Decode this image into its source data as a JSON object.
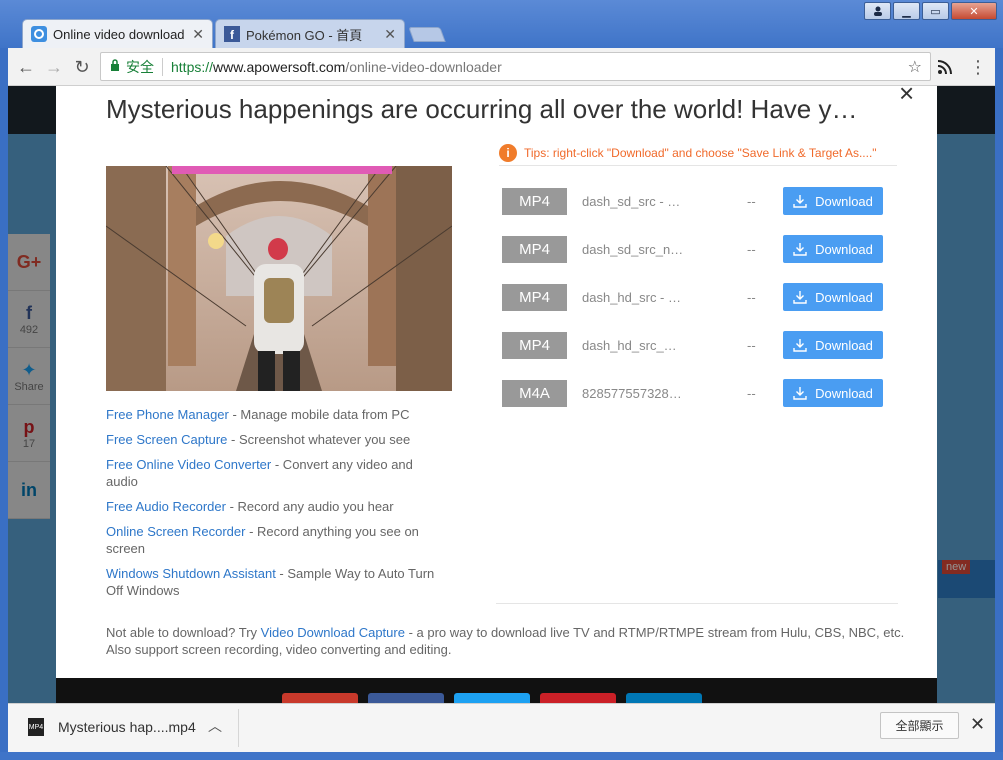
{
  "browser": {
    "tabs": [
      {
        "title": "Online video download",
        "icon": "site-favicon",
        "active": true
      },
      {
        "title": "Pokémon GO - 首頁",
        "icon": "facebook-favicon",
        "active": false
      }
    ],
    "url": {
      "security_label": "安全",
      "scheme": "https://",
      "host": "www.apowersoft.com",
      "path": "/online-video-downloader"
    }
  },
  "page": {
    "share": [
      {
        "icon": "G+",
        "count": ""
      },
      {
        "icon": "f",
        "count": "492"
      },
      {
        "icon": "t",
        "count": "Share"
      },
      {
        "icon": "p",
        "count": "17"
      },
      {
        "icon": "in",
        "count": ""
      }
    ],
    "badge": "new"
  },
  "modal": {
    "title": "Mysterious happenings are occurring all over the world! Have y…",
    "close_glyph": "×",
    "tips": "Tips: right-click \"Download\" and choose \"Save Link & Target As....\"",
    "downloads": [
      {
        "format": "MP4",
        "name": "dash_sd_src - …",
        "size": "--",
        "button": "Download"
      },
      {
        "format": "MP4",
        "name": "dash_sd_src_n…",
        "size": "--",
        "button": "Download"
      },
      {
        "format": "MP4",
        "name": "dash_hd_src - …",
        "size": "--",
        "button": "Download"
      },
      {
        "format": "MP4",
        "name": "dash_hd_src_…",
        "size": "--",
        "button": "Download"
      },
      {
        "format": "M4A",
        "name": "828577557328…",
        "size": "--",
        "button": "Download"
      }
    ],
    "links": [
      {
        "link": "Free Phone Manager",
        "desc": " - Manage mobile data from PC"
      },
      {
        "link": "Free Screen Capture",
        "desc": " - Screenshot whatever you see"
      },
      {
        "link": "Free Online Video Converter",
        "desc": " - Convert any video and audio"
      },
      {
        "link": "Free Audio Recorder",
        "desc": " - Record any audio you hear"
      },
      {
        "link": "Online Screen Recorder",
        "desc": " - Record anything you see on screen"
      },
      {
        "link": "Windows Shutdown Assistant",
        "desc": " - Sample Way to Auto Turn Off Windows"
      }
    ],
    "footnote": {
      "prefix": "Not able to download? Try ",
      "link": "Video Download Capture",
      "suffix": " - a pro way to download live TV and RTMP/RTMPE stream from Hulu, CBS, NBC, etc. Also support screen recording, video converting and editing."
    }
  },
  "shelf": {
    "file_name": "Mysterious hap....mp4",
    "file_icon_label": "MP4",
    "show_all": "全部顯示"
  }
}
